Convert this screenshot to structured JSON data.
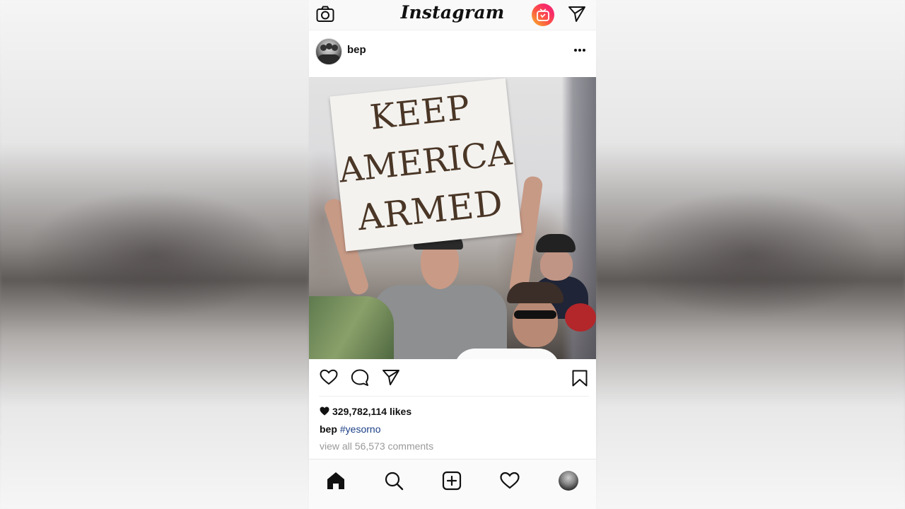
{
  "header": {
    "brand": "Instagram",
    "icons": [
      "camera-icon",
      "igtv-icon",
      "direct-icon"
    ]
  },
  "post": {
    "username": "bep",
    "image_text": {
      "line1": "KEEP",
      "line2": "AMERICA",
      "line3": "ARMED"
    },
    "likes_count": "329,782,114",
    "likes_label": "likes",
    "caption_user": "bep",
    "caption_hashtag": "#yesorno",
    "comments_link": "view all 56,573 comments"
  },
  "action_icons": [
    "heart-icon",
    "comment-icon",
    "share-icon",
    "bookmark-icon"
  ],
  "bottom_nav": [
    "home-icon",
    "search-icon",
    "add-icon",
    "activity-icon",
    "profile-icon"
  ]
}
